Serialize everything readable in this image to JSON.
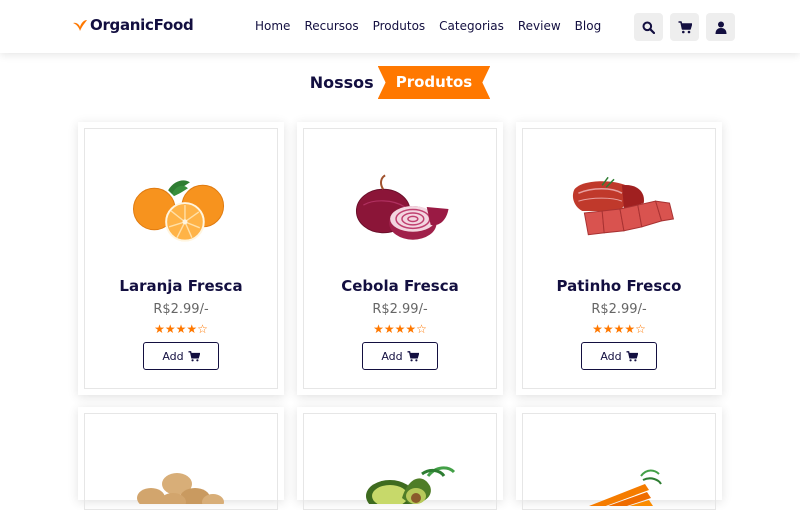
{
  "brand": {
    "name": "OrganicFood"
  },
  "nav": [
    "Home",
    "Recursos",
    "Produtos",
    "Categorias",
    "Review",
    "Blog"
  ],
  "header_icons": [
    "search-icon",
    "cart-icon",
    "user-icon"
  ],
  "section": {
    "title_plain": "Nossos",
    "title_tag": "Produtos"
  },
  "colors": {
    "accent": "#ff7800",
    "text": "#130f40"
  },
  "products": [
    {
      "name": "Laranja Fresca",
      "price": "R$2.99/-",
      "rating": 4.5,
      "button": "Add"
    },
    {
      "name": "Cebola Fresca",
      "price": "R$2.99/-",
      "rating": 4.5,
      "button": "Add"
    },
    {
      "name": "Patinho Fresco",
      "price": "R$2.99/-",
      "rating": 4.5,
      "button": "Add"
    }
  ]
}
